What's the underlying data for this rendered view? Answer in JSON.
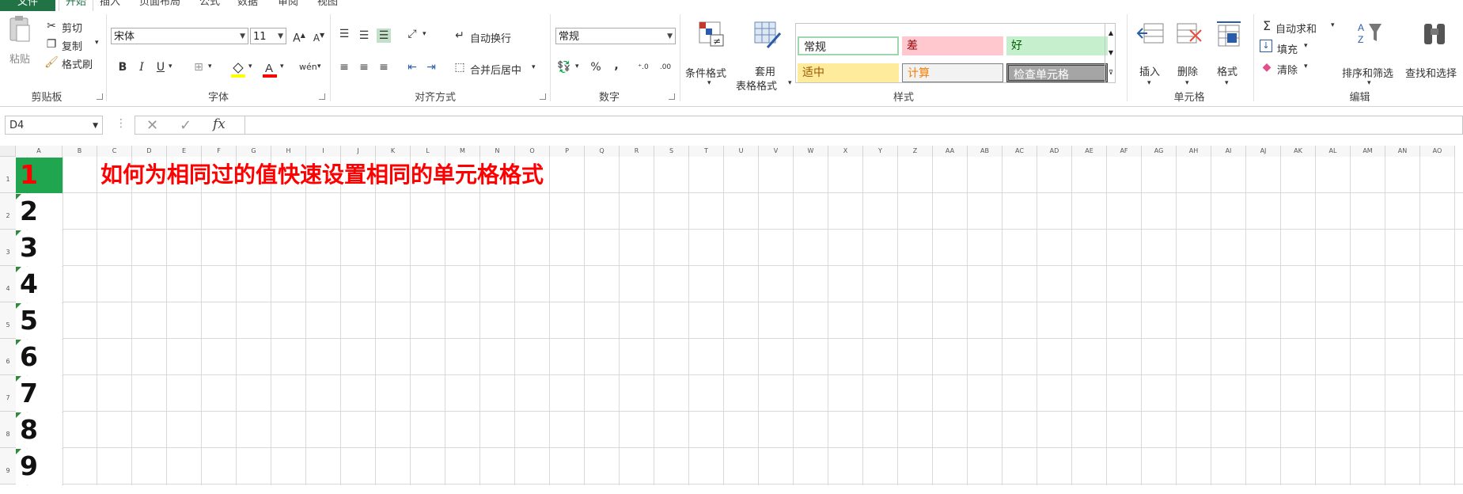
{
  "tabs": [
    "文件",
    "开始",
    "插入",
    "页面布局",
    "公式",
    "数据",
    "审阅",
    "视图"
  ],
  "clipboard": {
    "paste": "粘贴",
    "cut": "剪切",
    "copy": "复制",
    "format_painter": "格式刷",
    "label": "剪贴板"
  },
  "font": {
    "name": "宋体",
    "size": "11",
    "bold": "B",
    "italic": "I",
    "underline": "U",
    "label": "字体"
  },
  "alignment": {
    "wrap": "自动换行",
    "merge": "合并后居中",
    "label": "对齐方式"
  },
  "number": {
    "format": "常规",
    "percent": "%",
    "comma": ",",
    "label": "数字"
  },
  "styles": {
    "cond_format": "条件格式",
    "table_format_1": "套用",
    "table_format_2": "表格格式",
    "normal": "常规",
    "bad": "差",
    "good": "好",
    "neutral": "适中",
    "calc": "计算",
    "check": "检查单元格",
    "label": "样式"
  },
  "cells_group": {
    "insert": "插入",
    "delete": "删除",
    "format": "格式",
    "label": "单元格"
  },
  "editing": {
    "autosum": "自动求和",
    "fill": "填充",
    "clear": "清除",
    "sort": "排序和筛选",
    "find": "查找和选择",
    "label": "编辑"
  },
  "formula_bar": {
    "name_box": "D4",
    "fx": "fx",
    "value": ""
  },
  "columns": [
    "A",
    "B",
    "C",
    "D",
    "E",
    "F",
    "G",
    "H",
    "I",
    "J",
    "K",
    "L",
    "M",
    "N",
    "O",
    "P",
    "Q",
    "R",
    "S",
    "T",
    "U",
    "V",
    "W",
    "X",
    "Y",
    "Z",
    "AA",
    "AB",
    "AC",
    "AD",
    "AE",
    "AF",
    "AG",
    "AH",
    "AI",
    "AJ",
    "AK",
    "AL",
    "AM",
    "AN",
    "AO"
  ],
  "rows": [
    "1",
    "2",
    "3",
    "4",
    "5",
    "6",
    "7",
    "8",
    "9"
  ],
  "colA_values": [
    "1",
    "2",
    "3",
    "4",
    "5",
    "6",
    "7",
    "8",
    "9"
  ],
  "title_text": "如何为相同过的值快速设置相同的单元格格式",
  "colors": {
    "accent": "#217346",
    "red": "#ff0000",
    "selected_fill": "#21a650"
  }
}
